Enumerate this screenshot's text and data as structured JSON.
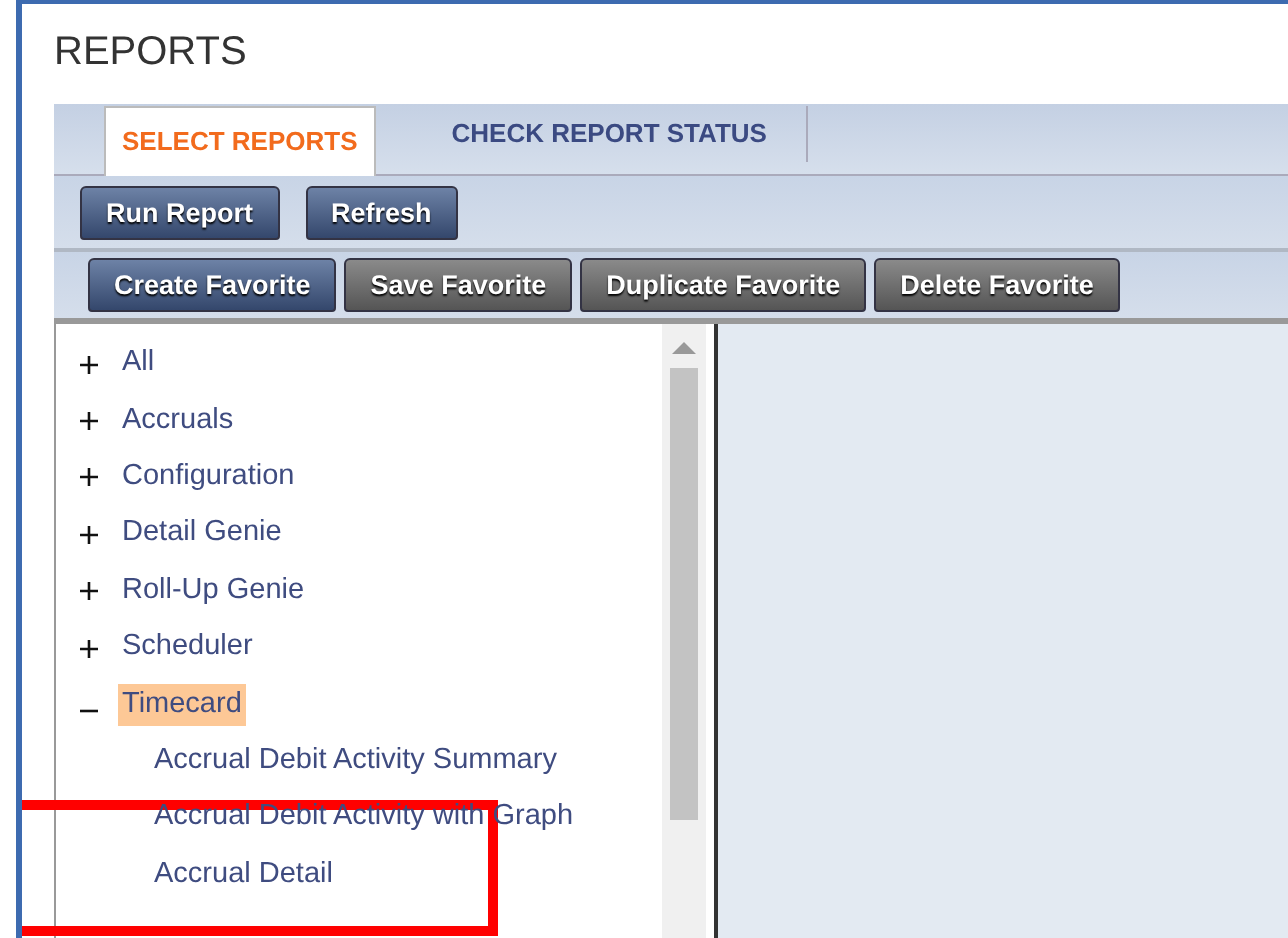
{
  "page": {
    "title": "REPORTS"
  },
  "tabs": [
    {
      "label": "SELECT REPORTS",
      "selected": true
    },
    {
      "label": "CHECK REPORT STATUS",
      "selected": false
    }
  ],
  "actions": [
    {
      "label": "Run Report"
    },
    {
      "label": "Refresh"
    }
  ],
  "favorite_buttons": [
    {
      "label": "Create Favorite",
      "kind": "primary"
    },
    {
      "label": "Save Favorite",
      "kind": "secondary"
    },
    {
      "label": "Duplicate Favorite",
      "kind": "secondary"
    },
    {
      "label": "Delete Favorite",
      "kind": "secondary"
    }
  ],
  "tree": [
    {
      "label": "All",
      "expanded": false,
      "selected": false
    },
    {
      "label": "Accruals",
      "expanded": false,
      "selected": false
    },
    {
      "label": "Configuration",
      "expanded": false,
      "selected": false
    },
    {
      "label": "Detail Genie",
      "expanded": false,
      "selected": false
    },
    {
      "label": "Roll-Up Genie",
      "expanded": false,
      "selected": false
    },
    {
      "label": "Scheduler",
      "expanded": false,
      "selected": false
    },
    {
      "label": "Timecard",
      "expanded": true,
      "selected": true,
      "children": [
        {
          "label": "Accrual Debit Activity Summary",
          "selected": false
        },
        {
          "label": "Accrual Debit Activity with Graph",
          "selected": false
        },
        {
          "label": "Accrual Detail",
          "selected": false
        }
      ]
    }
  ]
}
